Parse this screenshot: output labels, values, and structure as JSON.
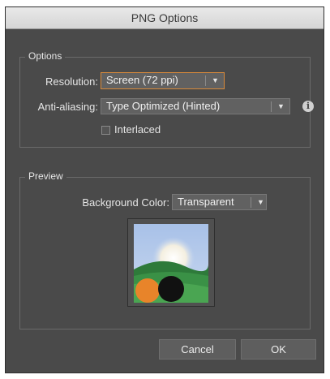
{
  "dialog": {
    "title": "PNG Options"
  },
  "options": {
    "legend": "Options",
    "resolution_label": "Resolution:",
    "resolution_value": "Screen (72 ppi)",
    "antialiasing_label": "Anti-aliasing:",
    "antialiasing_value": "Type Optimized (Hinted)",
    "info_icon": "i",
    "interlaced_label": "Interlaced",
    "interlaced_checked": false
  },
  "preview": {
    "legend": "Preview",
    "bg_color_label": "Background Color:",
    "bg_color_value": "Transparent"
  },
  "buttons": {
    "cancel": "Cancel",
    "ok": "OK"
  },
  "colors": {
    "focus_border": "#d98a3a",
    "dialog_bg": "#4a4a4a"
  }
}
